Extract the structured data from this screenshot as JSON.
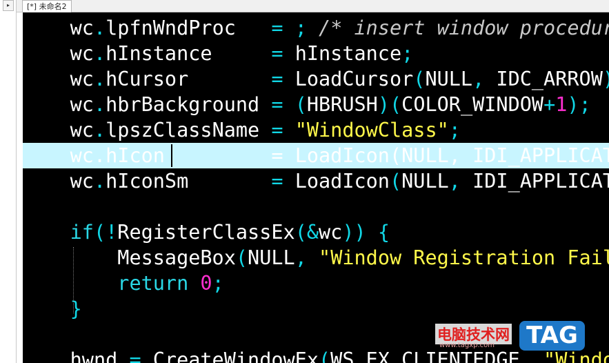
{
  "tab": {
    "title": "[*] 未命名2"
  },
  "colors": {
    "editor_bg": "#000000",
    "current_line_bg": "#c8f5ff",
    "punctuation": "#11d7e6",
    "number": "#ff2fd0",
    "string": "#fff84a",
    "comment": "#c8c8c8"
  },
  "code": {
    "l1": {
      "a": "wc",
      "b": ".",
      "c": "lpfnWndProc   ",
      "d": "=",
      "e": " ",
      "f": ";",
      "g": " /* insert window procedure */"
    },
    "l2": {
      "a": "wc",
      "b": ".",
      "c": "hInstance     ",
      "d": "=",
      "e": " hInstance",
      "f": ";"
    },
    "l3": {
      "a": "wc",
      "b": ".",
      "c": "hCursor       ",
      "d": "=",
      "e": " LoadCursor",
      "f": "(",
      "g": "NULL",
      "h": ",",
      "i": " IDC_ARROW",
      "j": ");"
    },
    "l4": {
      "a": "wc",
      "b": ".",
      "c": "hbrBackground ",
      "d": "=",
      "e": " ",
      "f": "(",
      "g": "HBRUSH",
      "h": ")(",
      "i": "COLOR_WINDOW",
      "j": "+",
      "k": "1",
      "l": ");"
    },
    "l5": {
      "a": "wc",
      "b": ".",
      "c": "lpszClassName ",
      "d": "=",
      "e": " ",
      "f": "\"WindowClass\"",
      "g": ";"
    },
    "l6": {
      "a": "wc",
      "b": ".",
      "c": "hIcon         ",
      "d": "=",
      "e": " LoadIcon",
      "f": "(",
      "g": "NULL",
      "h": ",",
      "i": " IDI_APPLICATION",
      "j": ");"
    },
    "l7": {
      "a": "wc",
      "b": ".",
      "c": "hIconSm       ",
      "d": "=",
      "e": " LoadIcon",
      "f": "(",
      "g": "NULL",
      "h": ",",
      "i": " IDI_APPLICATION",
      "j": ");"
    },
    "l9": {
      "a": "if",
      "b": "(!",
      "c": "RegisterClassEx",
      "d": "(&",
      "e": "wc",
      "f": "))",
      "g": " {"
    },
    "l10": {
      "a": "MessageBox",
      "b": "(",
      "c": "NULL",
      "d": ",",
      "e": " ",
      "f": "\"Window Registration Failed!\""
    },
    "l11": {
      "a": "return",
      "b": " ",
      "c": "0",
      "d": ";"
    },
    "l12": {
      "a": "}"
    },
    "l14": {
      "a": "hwnd ",
      "b": "=",
      "c": " CreateWindowEx",
      "d": "(",
      "e": "WS_EX_CLIENTEDGE",
      "f": ",",
      "g": " \"WindowClass\""
    }
  },
  "watermark": {
    "site_cn": "电脑技术网",
    "url": "www.tagxp.com",
    "tag": "TAG"
  }
}
